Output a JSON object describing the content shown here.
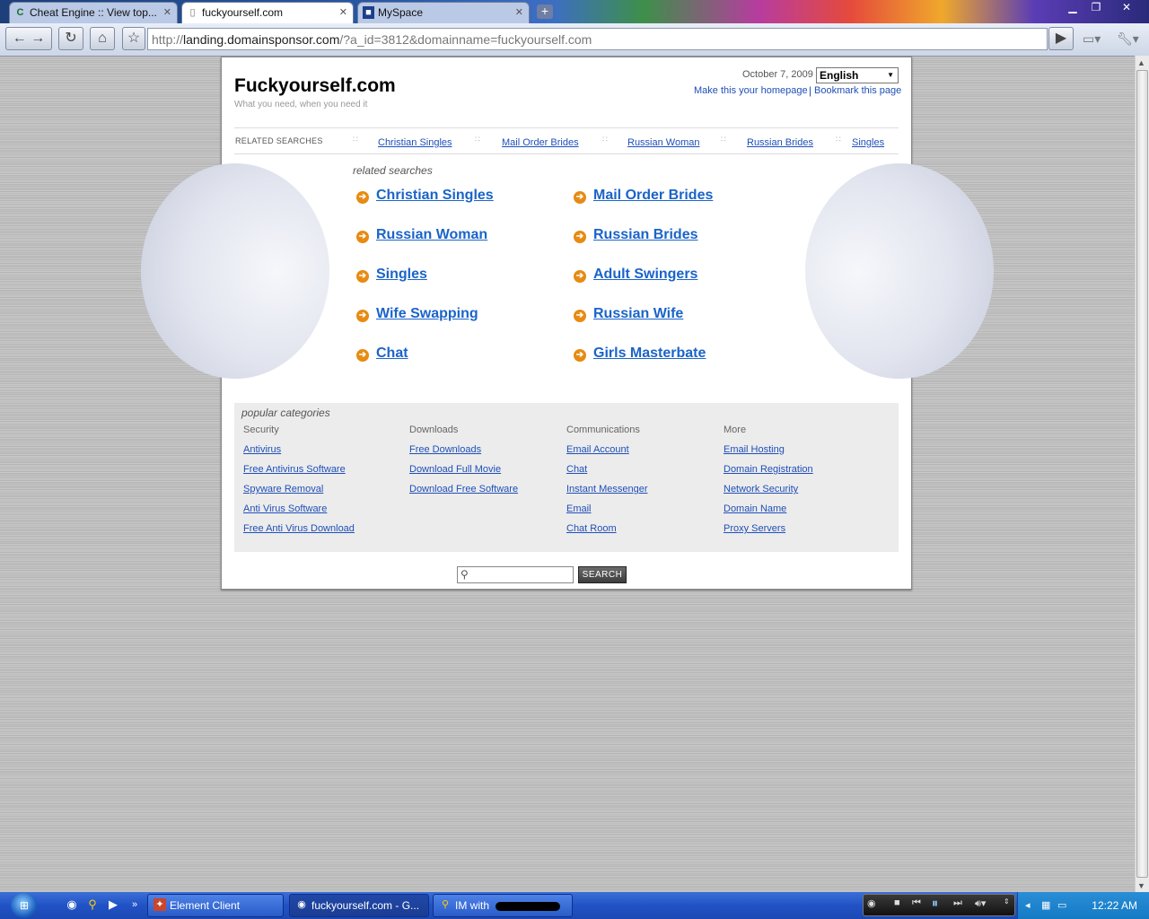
{
  "browser": {
    "tabs": [
      {
        "title": "Cheat Engine :: View top...",
        "icon": "cheat-engine-icon"
      },
      {
        "title": "fuckyourself.com",
        "icon": "page-icon"
      },
      {
        "title": "MySpace",
        "icon": "myspace-icon"
      }
    ],
    "url_prefix": "http://",
    "url_host": "landing.domainsponsor.com",
    "url_path": "/?a_id=3812&domainname=fuckyourself.com"
  },
  "page": {
    "site_title": "Fuckyourself.com",
    "tagline": "What you need, when you need it",
    "date": "October 7, 2009",
    "language": "English",
    "homepage_link": "Make this your homepage",
    "link_separator": "|",
    "bookmark_link": "Bookmark this page",
    "related_bar": {
      "label": "RELATED SEARCHES",
      "items": [
        "Christian Singles",
        "Mail Order Brides",
        "Russian Woman",
        "Russian Brides",
        "Singles"
      ]
    },
    "related_title": "related searches",
    "related_left": [
      "Christian Singles",
      "Russian Woman",
      "Singles",
      "Wife Swapping",
      "Chat"
    ],
    "related_right": [
      "Mail Order Brides",
      "Russian Brides",
      "Adult Swingers",
      "Russian Wife",
      "Girls Masterbate"
    ],
    "popular": {
      "title": "popular categories",
      "columns": [
        {
          "heading": "Security",
          "links": [
            "Antivirus",
            "Free Antivirus Software",
            "Spyware Removal",
            "Anti Virus Software",
            "Free Anti Virus Download"
          ]
        },
        {
          "heading": "Downloads",
          "links": [
            "Free Downloads",
            "Download Full Movie",
            "Download Free Software"
          ]
        },
        {
          "heading": "Communications",
          "links": [
            "Email Account",
            "Chat",
            "Instant Messenger",
            "Email",
            "Chat Room"
          ]
        },
        {
          "heading": "More",
          "links": [
            "Email Hosting",
            "Domain Registration",
            "Network Security",
            "Domain Name",
            "Proxy Servers"
          ]
        }
      ]
    },
    "search_button": "SEARCH"
  },
  "taskbar": {
    "buttons": [
      "Element Client",
      "fuckyourself.com - G...",
      "IM with"
    ],
    "clock": "12:22 AM"
  },
  "colors": {
    "link": "#1a64c9",
    "arrow": "#e78b12",
    "taskbar": "#2152c5"
  }
}
